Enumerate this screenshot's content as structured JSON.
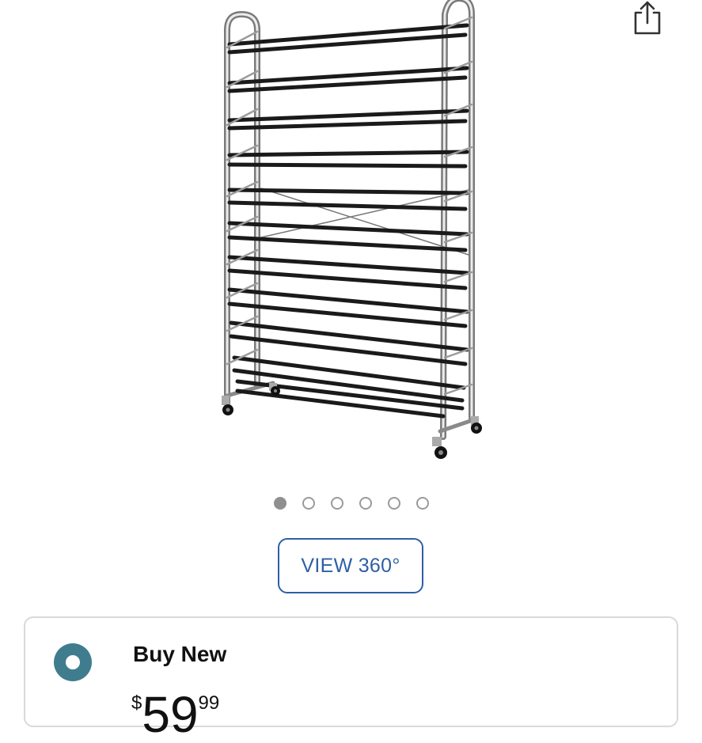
{
  "gallery": {
    "image_alt": "Chrome shoe rack tower",
    "dot_count": 6,
    "active_index": 0
  },
  "view360": {
    "label": "VIEW 360°"
  },
  "buy_option": {
    "title": "Buy New",
    "price": {
      "symbol": "$",
      "whole": "59",
      "fraction": "99"
    }
  },
  "colors": {
    "link": "#2f5fa5",
    "radio": "#3f7d8e",
    "border": "#d9d9d9"
  },
  "icons": {
    "share": "share-icon"
  }
}
